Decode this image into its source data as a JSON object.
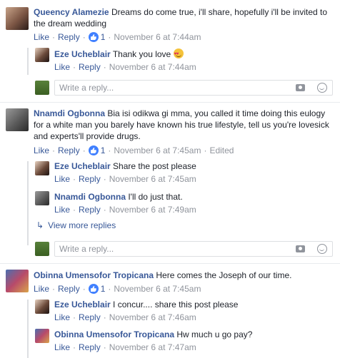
{
  "actions": {
    "like": "Like",
    "reply": "Reply"
  },
  "threads": [
    {
      "author": "Queency Alamezie",
      "text": "Dreams do come true, i'll share, hopefully i'll be invited to the dream wedding",
      "likes": "1",
      "time": "November 6 at 7:44am",
      "replies": [
        {
          "author": "Eze Ucheblair",
          "text": "Thank you love",
          "time": "November 6 at 7:44am",
          "emoji": "smiling-face-with-heart-eyes"
        }
      ],
      "reply_placeholder": "Write a reply..."
    },
    {
      "author": "Nnamdi Ogbonna",
      "text": "Bia isi odikwa gi mma, you called it time doing this eulogy for a white man you barely have known his true lifestyle, tell us you're lovesick and experts'll provide drugs.",
      "likes": "1",
      "time": "November 6 at 7:45am",
      "edited": "Edited",
      "replies": [
        {
          "author": "Eze Ucheblair",
          "text": "Share the post please",
          "time": "November 6 at 7:45am"
        },
        {
          "author": "Nnamdi Ogbonna",
          "text": "I'll do just that.",
          "time": "November 6 at 7:49am"
        }
      ],
      "view_more": "View more replies",
      "reply_placeholder": "Write a reply..."
    },
    {
      "author": "Obinna Umensofor Tropicana",
      "text": "Here comes the Joseph of our time.",
      "likes": "1",
      "time": "November 6 at 7:45am",
      "replies": [
        {
          "author": "Eze Ucheblair",
          "text": "I concur.... share this post please",
          "time": "November 6 at 7:46am"
        },
        {
          "author": "Obinna Umensofor Tropicana",
          "text": "Hw much u go pay?",
          "time": "November 6 at 7:47am"
        }
      ]
    }
  ],
  "colors": {
    "link": "#385898",
    "meta": "#90949c",
    "like_badge": "#4080ff",
    "border": "#dddfe2"
  }
}
